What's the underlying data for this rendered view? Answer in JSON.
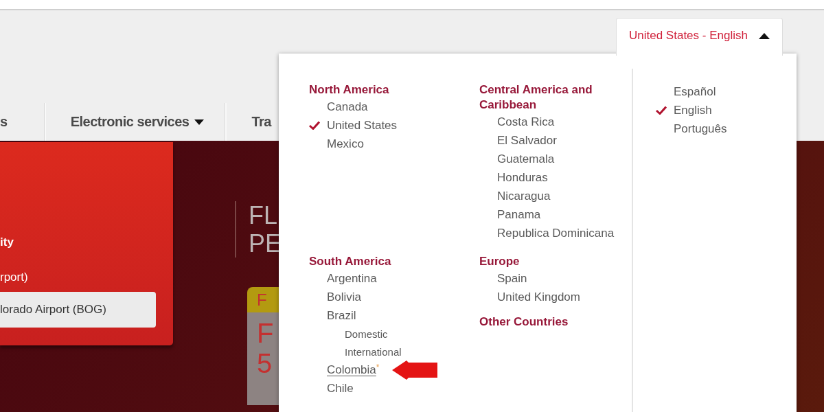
{
  "locale_toggle": {
    "label": "United States - English",
    "expanded": true
  },
  "nav": {
    "items": [
      {
        "label": "s",
        "kind": "link"
      },
      {
        "label": "Electronic services",
        "kind": "menu"
      },
      {
        "label": "Tra",
        "kind": "link"
      }
    ]
  },
  "search_card": {
    "heading": "ity",
    "label": "rport)",
    "field": {
      "value": "lorado Airport (BOG)"
    }
  },
  "promo": {
    "title_lines": [
      "FL",
      "PE"
    ],
    "badge": "F",
    "price_lines": [
      "F",
      "5"
    ]
  },
  "region_menu": {
    "columns": [
      {
        "regions": [
          {
            "name": "North America",
            "countries": [
              {
                "name": "Canada",
                "checked": false,
                "hovered": false
              },
              {
                "name": "United States",
                "checked": true,
                "hovered": false
              },
              {
                "name": "Mexico",
                "checked": false,
                "hovered": false
              }
            ]
          },
          {
            "name": "South America",
            "countries": [
              {
                "name": "Argentina",
                "checked": false,
                "hovered": false
              },
              {
                "name": "Bolivia",
                "checked": false,
                "hovered": false
              },
              {
                "name": "Brazil",
                "checked": false,
                "hovered": false,
                "children": [
                  {
                    "name": "Domestic",
                    "checked": false,
                    "hovered": false
                  },
                  {
                    "name": "International",
                    "checked": false,
                    "hovered": false
                  }
                ]
              },
              {
                "name": "Colombia",
                "checked": false,
                "hovered": true,
                "note": "*",
                "annotated": true
              },
              {
                "name": "Chile",
                "checked": false,
                "hovered": false
              }
            ]
          }
        ]
      },
      {
        "regions": [
          {
            "name": "Central America and Caribbean",
            "countries": [
              {
                "name": "Costa Rica",
                "checked": false,
                "hovered": false
              },
              {
                "name": "El Salvador",
                "checked": false,
                "hovered": false
              },
              {
                "name": "Guatemala",
                "checked": false,
                "hovered": false
              },
              {
                "name": "Honduras",
                "checked": false,
                "hovered": false
              },
              {
                "name": "Nicaragua",
                "checked": false,
                "hovered": false
              },
              {
                "name": "Panama",
                "checked": false,
                "hovered": false
              },
              {
                "name": "Republica Dominicana",
                "checked": false,
                "hovered": false
              }
            ]
          },
          {
            "name": "Europe",
            "countries": [
              {
                "name": "Spain",
                "checked": false,
                "hovered": false
              },
              {
                "name": "United Kingdom",
                "checked": false,
                "hovered": false
              }
            ]
          },
          {
            "name": "Other Countries"
          }
        ]
      }
    ],
    "languages": [
      {
        "name": "Español",
        "checked": false
      },
      {
        "name": "English",
        "checked": true
      },
      {
        "name": "Português",
        "checked": false
      }
    ]
  }
}
